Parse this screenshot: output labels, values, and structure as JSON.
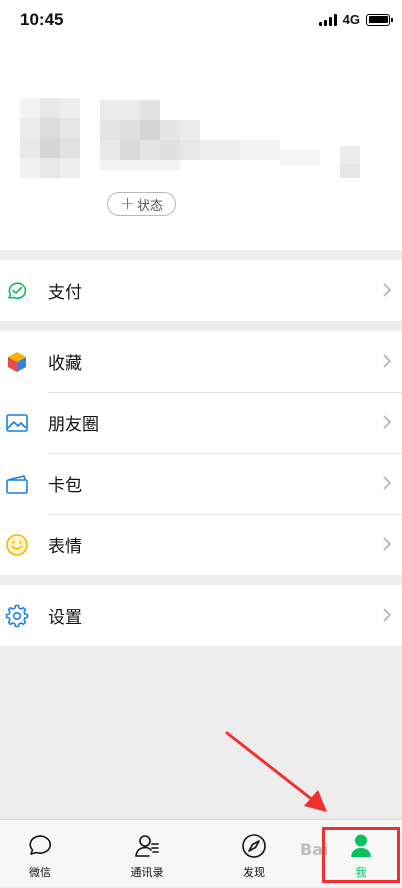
{
  "status_bar": {
    "time": "10:45",
    "network": "4G"
  },
  "profile": {
    "status_button": "状态"
  },
  "menu_groups": [
    {
      "items": [
        {
          "id": "pay",
          "label": "支付",
          "icon": "pay-icon"
        }
      ]
    },
    {
      "items": [
        {
          "id": "favorites",
          "label": "收藏",
          "icon": "favorites-cube-icon"
        },
        {
          "id": "moments",
          "label": "朋友圈",
          "icon": "moments-picture-icon"
        },
        {
          "id": "cards",
          "label": "卡包",
          "icon": "card-wallet-icon"
        },
        {
          "id": "stickers",
          "label": "表情",
          "icon": "smiley-icon"
        }
      ]
    },
    {
      "items": [
        {
          "id": "settings",
          "label": "设置",
          "icon": "settings-gear-icon"
        }
      ]
    }
  ],
  "tab_bar": {
    "tabs": [
      {
        "id": "chats",
        "label": "微信",
        "icon": "chat-bubble-icon",
        "active": false
      },
      {
        "id": "contacts",
        "label": "通讯录",
        "icon": "contacts-icon",
        "active": false
      },
      {
        "id": "discover",
        "label": "发现",
        "icon": "compass-icon",
        "active": false
      },
      {
        "id": "me",
        "label": "我",
        "icon": "person-icon",
        "active": true
      }
    ]
  },
  "colors": {
    "accent": "#07c160",
    "annotation": "#f03030",
    "icon_blue": "#1b7fe0"
  },
  "watermark": "Bai"
}
